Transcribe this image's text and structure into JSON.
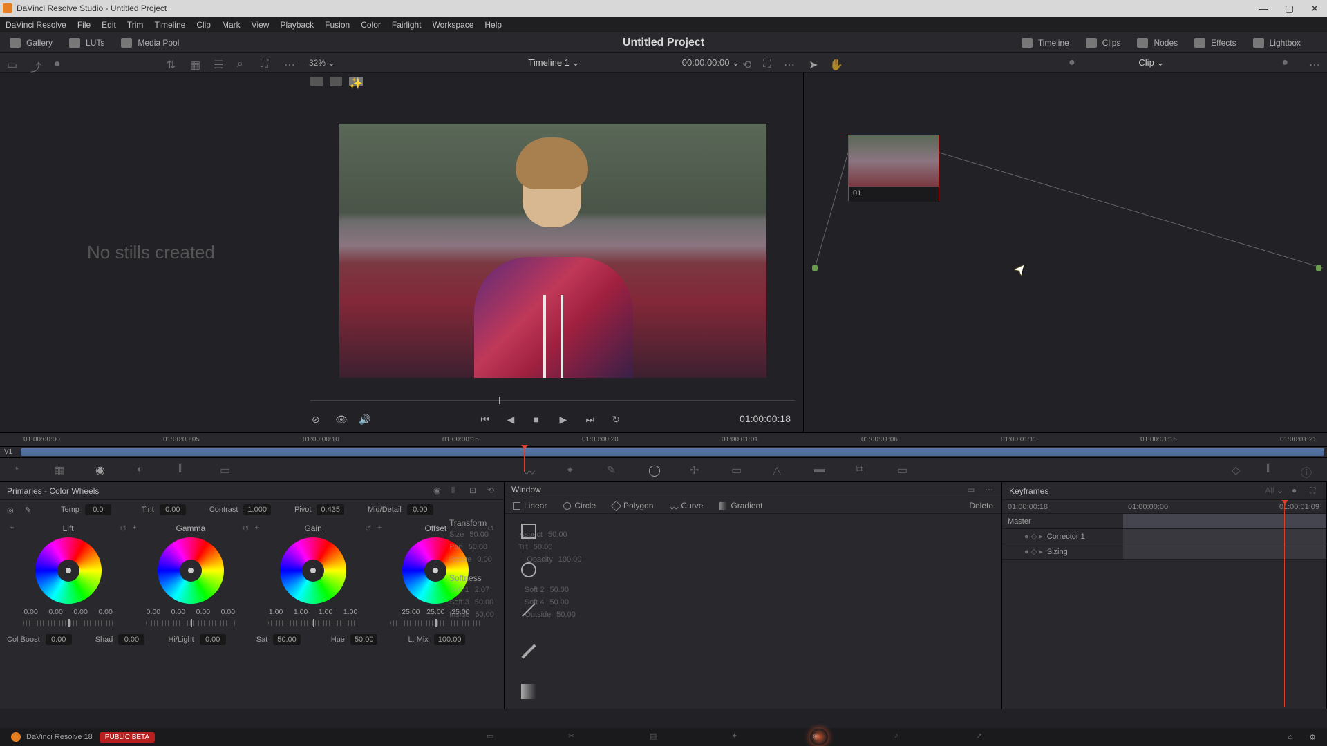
{
  "app": {
    "title": "DaVinci Resolve Studio - Untitled Project"
  },
  "menu": [
    "DaVinci Resolve",
    "File",
    "Edit",
    "Trim",
    "Timeline",
    "Clip",
    "Mark",
    "View",
    "Playback",
    "Fusion",
    "Color",
    "Fairlight",
    "Workspace",
    "Help"
  ],
  "toolbar": {
    "gallery": "Gallery",
    "luts": "LUTs",
    "media_pool": "Media Pool",
    "project": "Untitled Project",
    "timeline_btn": "Timeline",
    "clips": "Clips",
    "nodes": "Nodes",
    "effects": "Effects",
    "lightbox": "Lightbox"
  },
  "sec": {
    "zoom": "32%",
    "timeline": "Timeline 1",
    "timecode": "00:00:00:00",
    "mode": "Clip"
  },
  "gallery": {
    "empty": "No stills created"
  },
  "viewer": {
    "timecode": "01:00:00:18"
  },
  "node": {
    "label": "01"
  },
  "ruler": {
    "ticks": [
      "01:00:00:00",
      "01:00:00:05",
      "01:00:00:10",
      "01:00:00:15",
      "01:00:00:20",
      "01:00:01:01",
      "01:00:01:06",
      "01:00:01:11",
      "01:00:01:16",
      "01:00:01:21"
    ],
    "track": "V1"
  },
  "primaries": {
    "title": "Primaries - Color Wheels",
    "temp": {
      "label": "Temp",
      "val": "0.0"
    },
    "tint": {
      "label": "Tint",
      "val": "0.00"
    },
    "contrast": {
      "label": "Contrast",
      "val": "1.000"
    },
    "pivot": {
      "label": "Pivot",
      "val": "0.435"
    },
    "middetail": {
      "label": "Mid/Detail",
      "val": "0.00"
    },
    "wheels": [
      {
        "name": "Lift",
        "vals": [
          "0.00",
          "0.00",
          "0.00",
          "0.00"
        ]
      },
      {
        "name": "Gamma",
        "vals": [
          "0.00",
          "0.00",
          "0.00",
          "0.00"
        ]
      },
      {
        "name": "Gain",
        "vals": [
          "1.00",
          "1.00",
          "1.00",
          "1.00"
        ]
      },
      {
        "name": "Offset",
        "vals": [
          "25.00",
          "25.00",
          "25.00"
        ]
      }
    ],
    "bottom": {
      "colboost": {
        "label": "Col Boost",
        "val": "0.00"
      },
      "shad": {
        "label": "Shad",
        "val": "0.00"
      },
      "hilight": {
        "label": "Hi/Light",
        "val": "0.00"
      },
      "sat": {
        "label": "Sat",
        "val": "50.00"
      },
      "hue": {
        "label": "Hue",
        "val": "50.00"
      },
      "lmix": {
        "label": "L. Mix",
        "val": "100.00"
      }
    }
  },
  "window": {
    "title": "Window",
    "tabs": [
      "Linear",
      "Circle",
      "Polygon",
      "Curve",
      "Gradient",
      "Delete"
    ],
    "transform": {
      "title": "Transform",
      "params": {
        "size": "50.00",
        "aspect": "50.00",
        "pan": "50.00",
        "tilt": "50.00",
        "rotate": "0.00",
        "opacity": "100.00"
      },
      "labels": {
        "size": "Size",
        "aspect": "Aspect",
        "pan": "Pan",
        "tilt": "Tilt",
        "rotate": "Rotate",
        "opacity": "Opacity"
      }
    },
    "softness": {
      "title": "Softness",
      "params": {
        "soft1": "2.07",
        "soft2": "50.00",
        "soft3": "50.00",
        "soft4": "50.00",
        "inside": "50.00",
        "outside": "50.00"
      },
      "labels": {
        "soft1": "Soft 1",
        "soft2": "Soft 2",
        "soft3": "Soft 3",
        "soft4": "Soft 4",
        "inside": "Inside",
        "outside": "Outside"
      }
    }
  },
  "keyframes": {
    "title": "Keyframes",
    "filter": "All",
    "time": "01:00:00:18",
    "ruler": [
      "01:00:00:00",
      "01:00:01:09"
    ],
    "rows": [
      "Master",
      "Corrector 1",
      "Sizing"
    ]
  },
  "footer": {
    "version": "DaVinci Resolve 18",
    "beta": "PUBLIC BETA"
  }
}
